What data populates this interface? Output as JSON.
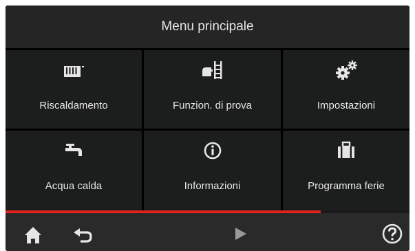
{
  "header": {
    "title": "Menu principale"
  },
  "menu": {
    "items": [
      {
        "label": "Riscaldamento",
        "icon": "radiator-icon"
      },
      {
        "label": "Funzion. di prova",
        "icon": "ladder-test-icon"
      },
      {
        "label": "Impostazioni",
        "icon": "gears-icon"
      },
      {
        "label": "Acqua calda",
        "icon": "faucet-icon"
      },
      {
        "label": "Informazioni",
        "icon": "info-icon"
      },
      {
        "label": "Programma ferie",
        "icon": "suitcase-icon"
      }
    ]
  },
  "progress": {
    "value": 0.78,
    "color": "#e0241b"
  },
  "footer": {
    "home_icon": "home-icon",
    "back_icon": "back-arrow-icon",
    "next_icon": "play-next-icon",
    "help_icon": "help-icon"
  },
  "colors": {
    "tile": "#1c1d1d",
    "header": "#252525",
    "accent": "#e0241b"
  }
}
